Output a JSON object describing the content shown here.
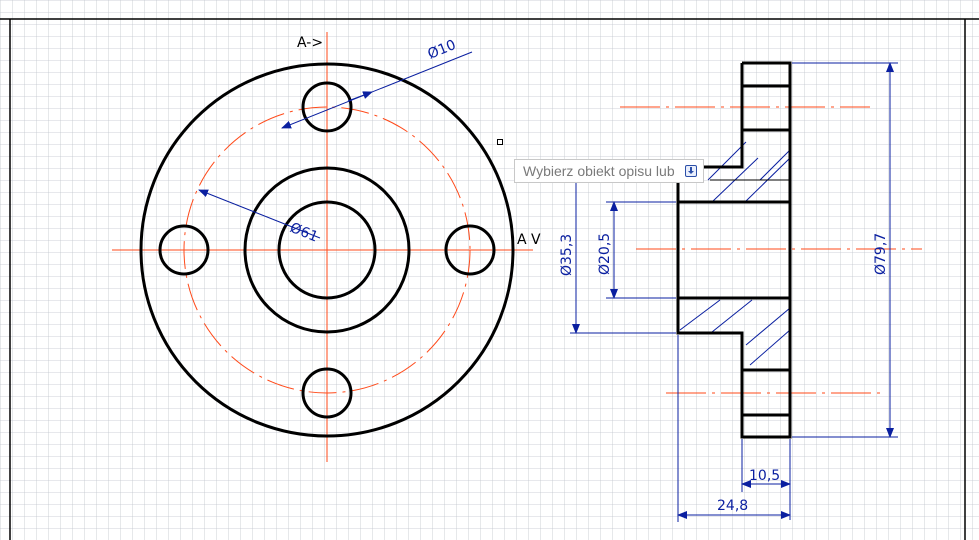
{
  "colors": {
    "grid": "#bfc4cc",
    "outline": "#000000",
    "centerline": "#ff4a1a",
    "dimension": "#0a1fa0"
  },
  "section_marks": {
    "top": "A->",
    "right": "A V"
  },
  "dimensions": {
    "hole_diameter": "Ø10",
    "bolt_circle": "Ø61",
    "outer_diameter": "Ø79,7",
    "hub_diameter": "Ø35,3",
    "bore_diameter": "Ø20,5",
    "flange_thickness": "10,5",
    "total_length": "24,8"
  },
  "tooltip": {
    "text": "Wybierz obiekt opisu lub",
    "icon": "expand-down-icon"
  }
}
